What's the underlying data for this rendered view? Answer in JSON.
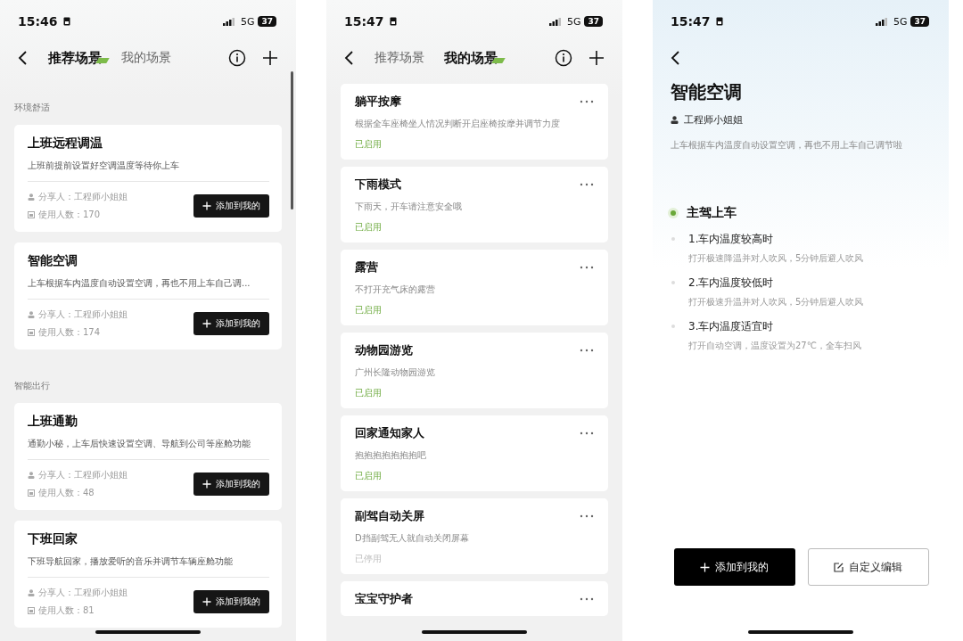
{
  "screens": [
    {
      "kind": "recommended",
      "status": {
        "time": "15:46",
        "network": "5G",
        "battery": "37"
      },
      "tabs": [
        {
          "label": "推荐场景",
          "selected": true
        },
        {
          "label": "我的场景",
          "selected": false
        }
      ],
      "sections": [
        {
          "title": "环境舒适",
          "cards": [
            {
              "title": "上班远程调温",
              "desc": "上班前提前设置好空调温度等待你上车",
              "sharer": "分享人：工程师小姐姐",
              "users": "使用人数：170",
              "button": "添加到我的"
            },
            {
              "title": "智能空调",
              "desc": "上车根据车内温度自动设置空调，再也不用上车自己调...",
              "sharer": "分享人：工程师小姐姐",
              "users": "使用人数：174",
              "button": "添加到我的"
            }
          ]
        },
        {
          "title": "智能出行",
          "cards": [
            {
              "title": "上班通勤",
              "desc": "通勤小秘，上车后快速设置空调、导航到公司等座舱功能",
              "sharer": "分享人：工程师小姐姐",
              "users": "使用人数：48",
              "button": "添加到我的"
            },
            {
              "title": "下班回家",
              "desc": "下班导航回家，播放爱听的音乐并调节车辆座舱功能",
              "sharer": "分享人：工程师小姐姐",
              "users": "使用人数：81",
              "button": "添加到我的"
            }
          ]
        }
      ]
    },
    {
      "kind": "mine",
      "status": {
        "time": "15:47",
        "network": "5G",
        "battery": "37"
      },
      "tabs": [
        {
          "label": "推荐场景",
          "selected": false
        },
        {
          "label": "我的场景",
          "selected": true
        }
      ],
      "scenes": [
        {
          "title": "躺平按摩",
          "desc": "根据全车座椅坐人情况判断开启座椅按摩并调节力度",
          "status": "已启用",
          "enabled": true
        },
        {
          "title": "下雨模式",
          "desc": "下雨天，开车请注意安全哦",
          "status": "已启用",
          "enabled": true
        },
        {
          "title": "露营",
          "desc": "不打开充气床的露营",
          "status": "已启用",
          "enabled": true
        },
        {
          "title": "动物园游览",
          "desc": "广州长隆动物园游览",
          "status": "已启用",
          "enabled": true
        },
        {
          "title": "回家通知家人",
          "desc": "抱抱抱抱抱抱抱吧",
          "status": "已启用",
          "enabled": true
        },
        {
          "title": "副驾自动关屏",
          "desc": "D挡副驾无人就自动关闭屏幕",
          "status": "已停用",
          "enabled": false
        },
        {
          "title": "宝宝守护者"
        }
      ]
    },
    {
      "kind": "detail",
      "status": {
        "time": "15:47",
        "network": "5G",
        "battery": "37"
      },
      "title": "智能空调",
      "author": "工程师小姐姐",
      "desc": "上车根据车内温度自动设置空调，再也不用上车自己调节啦",
      "trigger": {
        "title": "主驾上车",
        "active": true
      },
      "steps": [
        {
          "title": "1.车内温度较高时",
          "desc": "打开极速降温并对人吹风，5分钟后避人吹风"
        },
        {
          "title": "2.车内温度较低时",
          "desc": "打开极速升温并对人吹风，5分钟后避人吹风"
        },
        {
          "title": "3.车内温度适宜时",
          "desc": "打开自动空调，温度设置为27℃，全车扫风"
        }
      ],
      "buttons": [
        {
          "label": "添加到我的",
          "kind": "primary"
        },
        {
          "label": "自定义编辑",
          "kind": "secondary"
        }
      ]
    }
  ]
}
